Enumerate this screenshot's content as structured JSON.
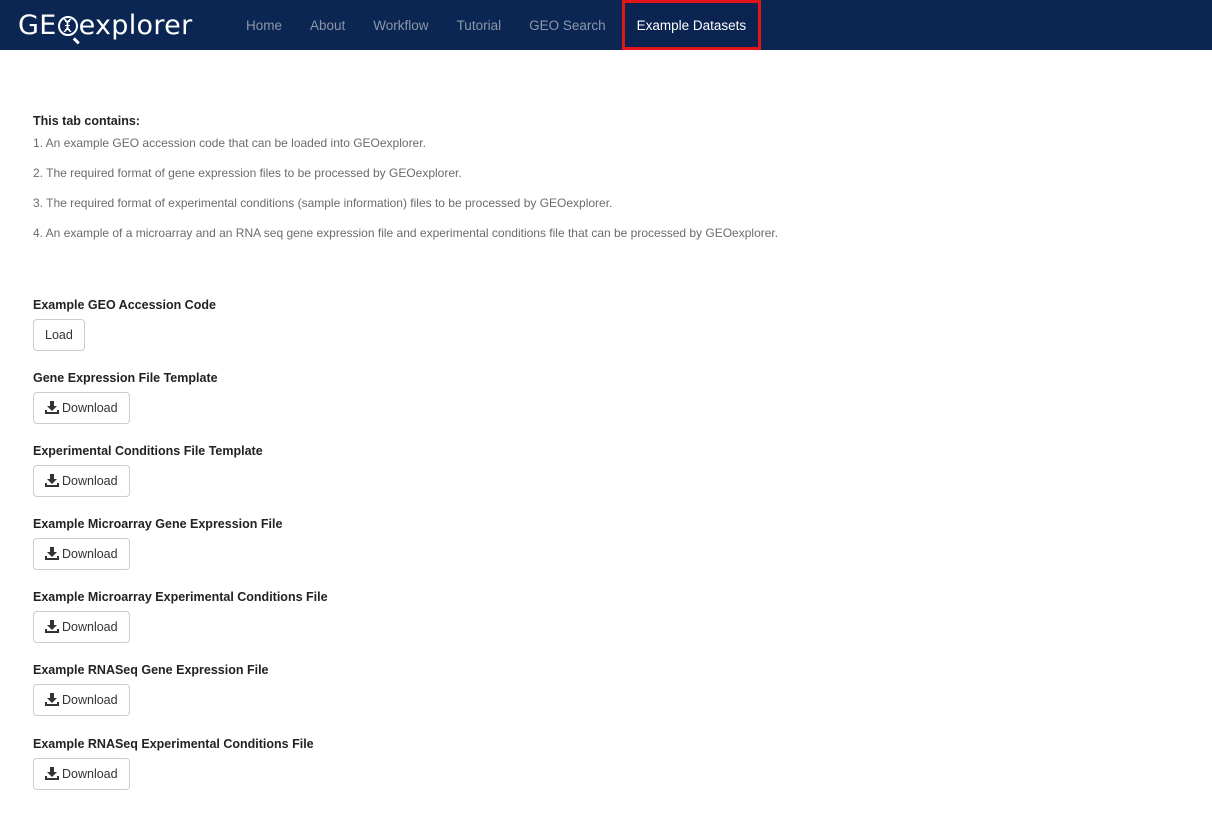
{
  "app": {
    "brand_prefix": "GE",
    "brand_suffix": "explorer"
  },
  "nav": {
    "items": [
      {
        "label": "Home"
      },
      {
        "label": "About"
      },
      {
        "label": "Workflow"
      },
      {
        "label": "Tutorial"
      },
      {
        "label": "GEO Search"
      },
      {
        "label": "Example Datasets",
        "active": true
      }
    ]
  },
  "intro": {
    "heading": "This tab contains:",
    "items": [
      "1. An example GEO accession code that can be loaded into GEOexplorer.",
      "2. The required format of gene expression files to be processed by GEOexplorer.",
      "3. The required format of experimental conditions (sample information) files to be processed by GEOexplorer.",
      "4. An example of a microarray and an RNA seq gene expression file and experimental conditions file that can be processed by GEOexplorer."
    ]
  },
  "sections": [
    {
      "label": "Example GEO Accession Code",
      "button": "Load",
      "icon": ""
    },
    {
      "label": "Gene Expression File Template",
      "button": "Download",
      "icon": "download-icon"
    },
    {
      "label": "Experimental Conditions File Template",
      "button": "Download",
      "icon": "download-icon"
    },
    {
      "label": "Example Microarray Gene Expression File",
      "button": "Download",
      "icon": "download-icon"
    },
    {
      "label": "Example Microarray Experimental Conditions File",
      "button": "Download",
      "icon": "download-icon"
    },
    {
      "label": "Example RNASeq Gene Expression File",
      "button": "Download",
      "icon": "download-icon"
    },
    {
      "label": "Example RNASeq Experimental Conditions File",
      "button": "Download",
      "icon": "download-icon"
    }
  ],
  "colors": {
    "navbar_bg": "#0b2653",
    "active_highlight": "#e3151b",
    "nav_text_inactive": "#8c96a8",
    "nav_text_active": "#ffffff"
  }
}
